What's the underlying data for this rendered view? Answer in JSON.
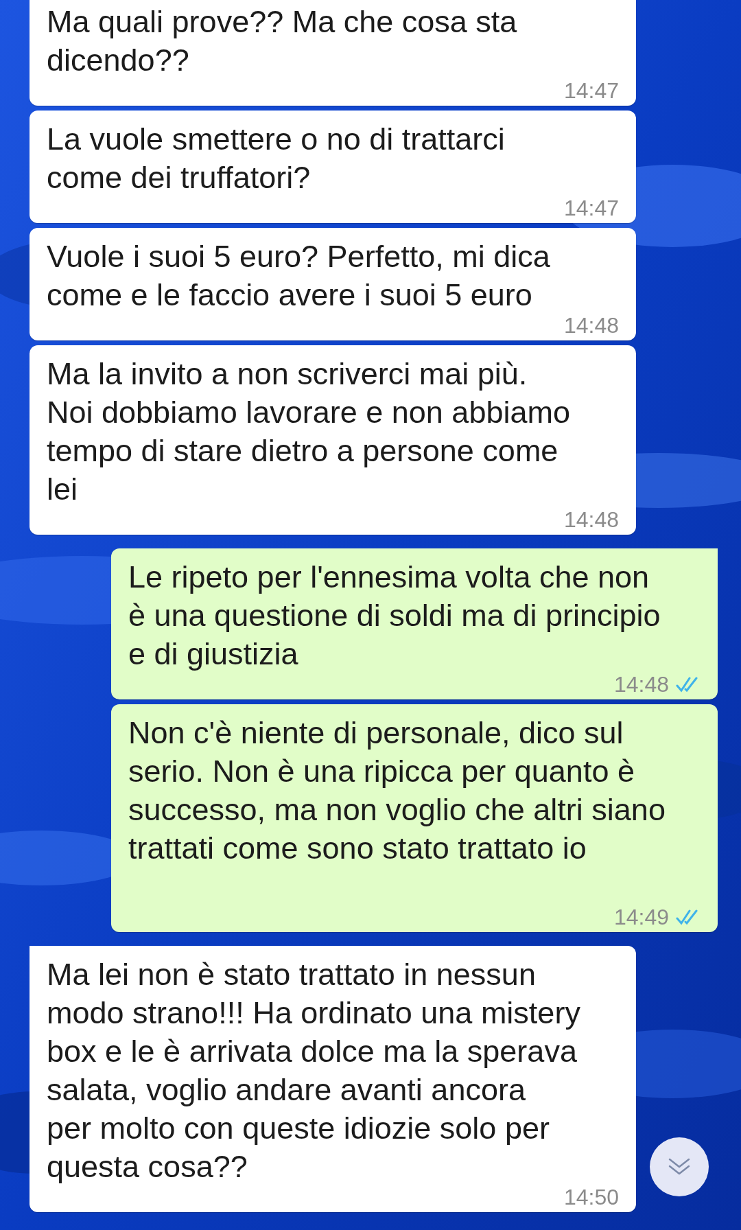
{
  "messages": [
    {
      "kind": "in",
      "tail": true,
      "text": "Ma quali prove?? Ma che cosa sta\ndicendo??",
      "time": "14:47"
    },
    {
      "kind": "in",
      "tail": false,
      "text": "La vuole smettere o no di trattarci\ncome dei truffatori?",
      "time": "14:47"
    },
    {
      "kind": "in",
      "tail": false,
      "text": "Vuole i suoi 5 euro? Perfetto, mi dica\ncome e le faccio avere i suoi 5 euro",
      "time": "14:48"
    },
    {
      "kind": "in",
      "tail": false,
      "text": "Ma la invito a non scriverci mai più.\nNoi dobbiamo lavorare e non abbiamo\ntempo di stare dietro a persone come\nlei",
      "time": "14:48"
    },
    {
      "kind": "out",
      "tail": true,
      "read": true,
      "text": "Le ripeto per l'ennesima volta che non\nè una questione di soldi ma di principio\ne di giustizia",
      "time": "14:48"
    },
    {
      "kind": "out",
      "tail": false,
      "read": true,
      "text": "Non c'è niente di personale, dico sul\nserio. Non è una ripicca per quanto è\nsuccesso, ma non voglio che altri siano\ntrattati come sono stato trattato io",
      "time": "14:49"
    },
    {
      "kind": "in",
      "tail": true,
      "text": "Ma lei non è stato trattato in nessun\nmodo strano!!! Ha ordinato una mistery\nbox e le è arrivata dolce ma la sperava\nsalata, voglio andare avanti ancora\nper molto con queste idiozie solo per\nquesta cosa??",
      "time": "14:50"
    }
  ]
}
